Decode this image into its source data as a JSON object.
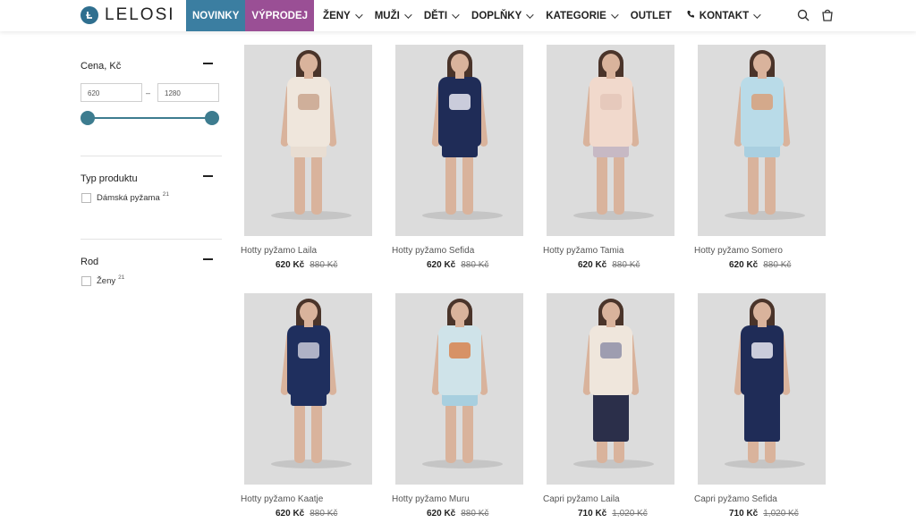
{
  "header": {
    "logo_text": "LELOSI",
    "nav": [
      {
        "label": "NOVINKY",
        "has_chevron": false,
        "style": "novinky"
      },
      {
        "label": "VÝPRODEJ",
        "has_chevron": false,
        "style": "vyprodej"
      },
      {
        "label": "ŽENY",
        "has_chevron": true
      },
      {
        "label": "MUŽI",
        "has_chevron": true
      },
      {
        "label": "DĚTI",
        "has_chevron": true
      },
      {
        "label": "DOPLŇKY",
        "has_chevron": true
      },
      {
        "label": "KATEGORIE",
        "has_chevron": true
      },
      {
        "label": "OUTLET",
        "has_chevron": false
      },
      {
        "label": "KONTAKT",
        "has_chevron": true,
        "icon": "phone-icon"
      }
    ],
    "icons": [
      "search-icon",
      "cart-icon"
    ],
    "colors": {
      "novinky": "#3b7ea1",
      "vyprodej": "#9a4f95",
      "accent": "#3d7c8f"
    }
  },
  "filters": {
    "price": {
      "title": "Cena, Kč",
      "min_value": "620",
      "max_value": "1280",
      "separator": "–"
    },
    "product_type": {
      "title": "Typ produktu",
      "options": [
        {
          "label": "Dámská pyžama",
          "count": "21"
        }
      ]
    },
    "gender": {
      "title": "Rod",
      "options": [
        {
          "label": "Ženy",
          "count": "21"
        }
      ]
    }
  },
  "products": [
    {
      "name": "Hotty pyžamo Laila",
      "price": "620 Kč",
      "old_price": "880 Kč",
      "top_color": "#efe6dc",
      "bottom_color": "#e8ddd2",
      "print_color": "#c9a48e",
      "long": false
    },
    {
      "name": "Hotty pyžamo Sefida",
      "price": "620 Kč",
      "old_price": "880 Kč",
      "top_color": "#1f2c57",
      "bottom_color": "#1f2c57",
      "print_color": "#e9e9f2",
      "long": false
    },
    {
      "name": "Hotty pyžamo Tamia",
      "price": "620 Kč",
      "old_price": "880 Kč",
      "top_color": "#f1d9cc",
      "bottom_color": "#c7b9c4",
      "print_color": "#e4c6b9",
      "long": false
    },
    {
      "name": "Hotty pyžamo Somero",
      "price": "620 Kč",
      "old_price": "880 Kč",
      "top_color": "#b9dbe8",
      "bottom_color": "#a9cfe0",
      "print_color": "#d8a07a",
      "long": false
    },
    {
      "name": "Hotty pyžamo Kaatje",
      "price": "620 Kč",
      "old_price": "880 Kč",
      "top_color": "#1f2f5e",
      "bottom_color": "#1f2f5e",
      "print_color": "#c9c9d8",
      "long": false
    },
    {
      "name": "Hotty pyžamo Muru",
      "price": "620 Kč",
      "old_price": "880 Kč",
      "top_color": "#cfe3e9",
      "bottom_color": "#a8cfdf",
      "print_color": "#d8844f",
      "long": false
    },
    {
      "name": "Capri pyžamo Laila",
      "price": "710 Kč",
      "old_price": "1,020 Kč",
      "top_color": "#efe6dc",
      "bottom_color": "#2b2f4a",
      "print_color": "#8f8fa8",
      "long": true
    },
    {
      "name": "Capri pyžamo Sefida",
      "price": "710 Kč",
      "old_price": "1,020 Kč",
      "top_color": "#1f2c57",
      "bottom_color": "#1f2c57",
      "print_color": "#e9e9f2",
      "long": true
    }
  ]
}
